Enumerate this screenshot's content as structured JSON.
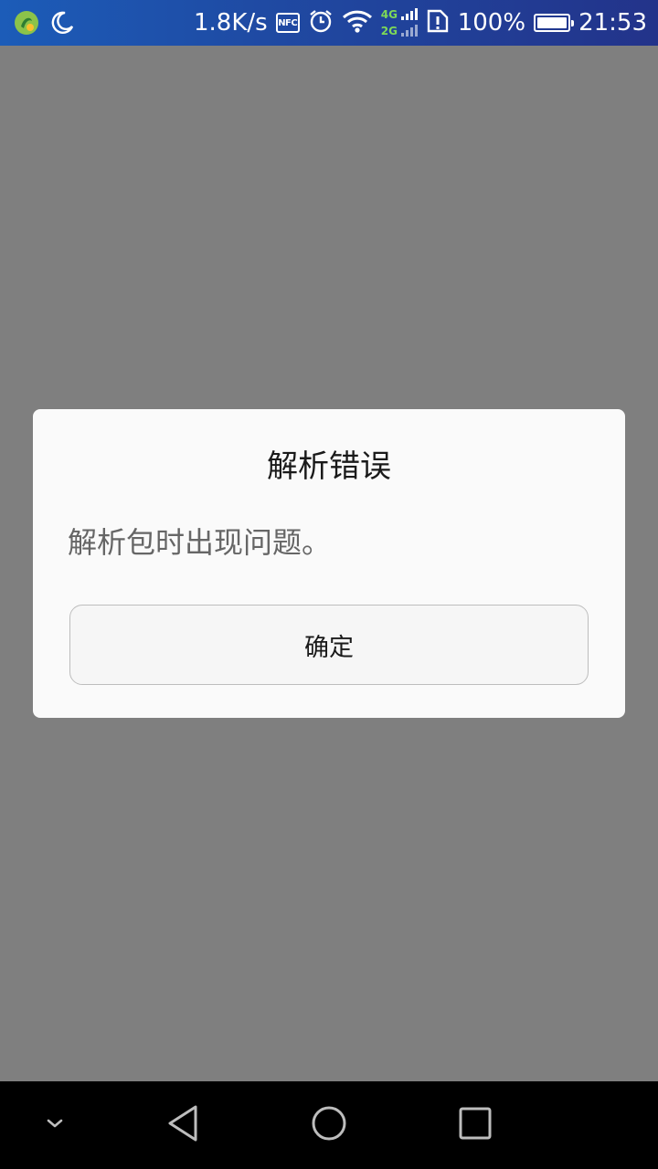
{
  "status_bar": {
    "net_speed": "1.8K/s",
    "nfc_label": "NFC",
    "net_4g": "4G",
    "net_2g": "2G",
    "battery": "100%",
    "time": "21:53",
    "icons": [
      "app-status-icon",
      "moon-icon",
      "nfc-icon",
      "alarm-icon",
      "wifi-icon",
      "cellular-signal-icon",
      "sim-alert-icon",
      "battery-icon"
    ]
  },
  "dialog": {
    "title": "解析错误",
    "message": "解析包时出现问题。",
    "ok_label": "确定"
  },
  "nav_bar": {
    "icons": [
      "chevron-down-icon",
      "back-icon",
      "home-icon",
      "recents-icon"
    ]
  },
  "colors": {
    "scrim": "#7f7f7f",
    "dialog_bg": "#fafafa",
    "status_bar_start": "#1c5cb8",
    "status_bar_end": "#23338a",
    "nav_bar": "#000000",
    "signal_green": "#7ed957"
  }
}
